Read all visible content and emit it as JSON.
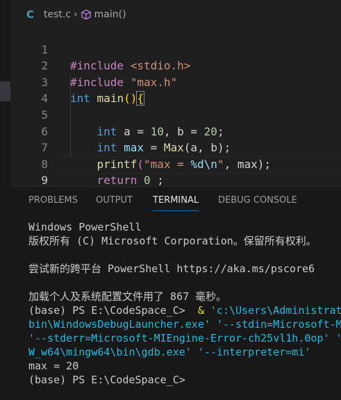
{
  "breadcrumb": {
    "file_icon": "C",
    "file": "test.c",
    "separator": "›",
    "symbol": "main()"
  },
  "code_lines": [
    {
      "n": "1"
    },
    {
      "n": "2"
    },
    {
      "n": "3"
    },
    {
      "n": "4"
    },
    {
      "n": "5"
    },
    {
      "n": "6"
    },
    {
      "n": "7"
    },
    {
      "n": "8"
    },
    {
      "n": "9"
    }
  ],
  "code": {
    "l1_directive": "#include",
    "l1_header": "<stdio.h>",
    "l2_directive": "#include",
    "l2_header": "\"max.h\"",
    "l3_type": "int",
    "l3_name": "main",
    "l3_parens": "()",
    "l3_brace": "{",
    "l5_type": "int",
    "l5_rest_a": " a = ",
    "l5_num1": "10",
    "l5_rest_b": ", b = ",
    "l5_num2": "20",
    "l5_end": ";",
    "l6_type": "int",
    "l6_var": "max",
    "l6_eq": " = ",
    "l6_fn": "Max",
    "l6_args": "(a, b);",
    "l7_fn": "printf",
    "l7_open": "(",
    "l7_str1": "\"max = ",
    "l7_fmt": "%d\\n",
    "l7_str2": "\"",
    "l7_rest": ", max);",
    "l8_kw": "return",
    "l8_num": "0",
    "l8_end": " ;",
    "l9_brace": "}"
  },
  "panel": {
    "tabs": [
      "PROBLEMS",
      "OUTPUT",
      "TERMINAL",
      "DEBUG CONSOLE"
    ],
    "active_tab": "TERMINAL"
  },
  "terminal": {
    "l1": "Windows PowerShell",
    "l2": "版权所有 (C) Microsoft Corporation。保留所有权利。",
    "l3": "尝试新的跨平台 PowerShell https://aka.ms/pscore6",
    "l4": "加载个人及系统配置文件用了 867 毫秒。",
    "l5_prompt": "(base) PS E:\\CodeSpace_C>  ",
    "l5_amp": "& ",
    "l5_path": "'c:\\Users\\Administrat",
    "l6": "bin\\WindowsDebugLauncher.exe' '--stdin=Microsoft-MI",
    "l7": "'--stderr=Microsoft-MIEngine-Error-ch25vl1h.0op' '",
    "l8": "W_w64\\mingw64\\bin\\gdb.exe' '--interpreter=mi'",
    "l9": "max = 20",
    "l10": "(base) PS E:\\CodeSpace_C>"
  },
  "colors": {
    "editor_bg": "#1f1f1f",
    "panel_bg": "#181818",
    "keyword": "#569cd6",
    "string": "#ce9178",
    "function": "#dcdcaa",
    "variable": "#9cdcfe",
    "number": "#b5cea8",
    "terminal_path": "#29b8db",
    "tab_accent": "#0078d4"
  }
}
